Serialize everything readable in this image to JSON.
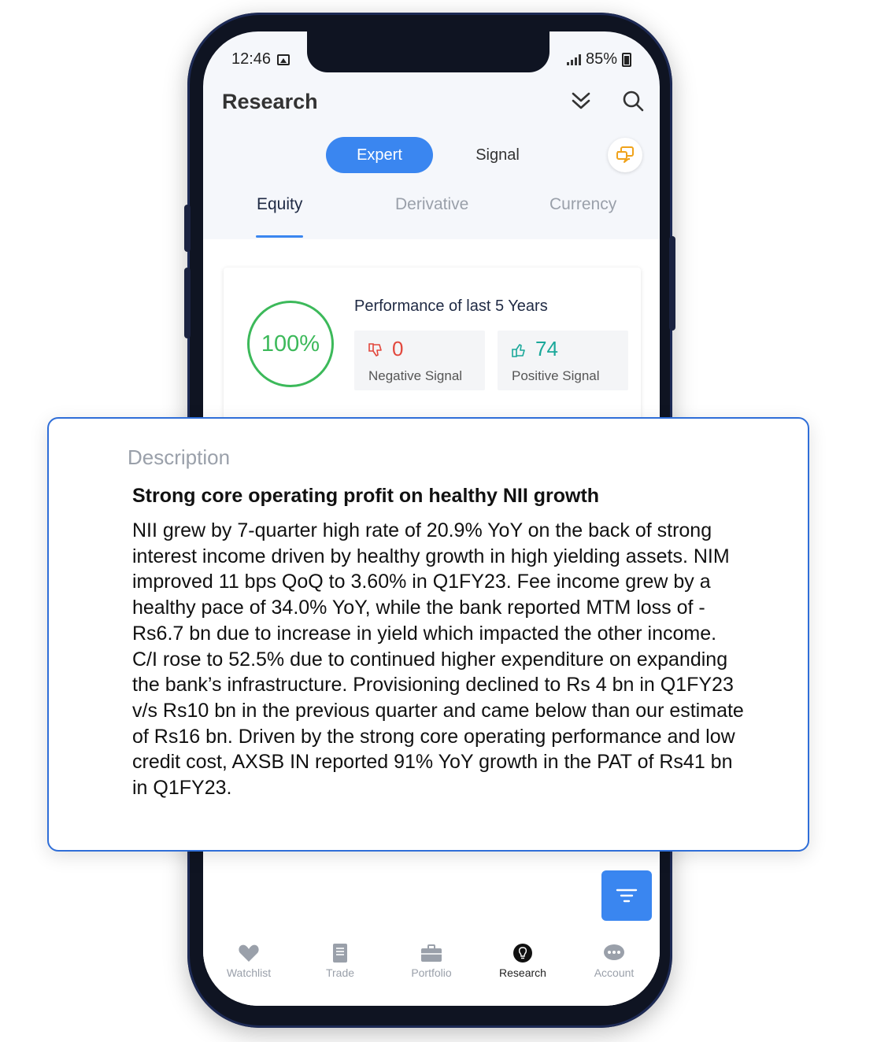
{
  "status_bar": {
    "time": "12:46",
    "battery": "85%"
  },
  "header": {
    "title": "Research",
    "icons": [
      "double-chevron-down-icon",
      "search-icon"
    ]
  },
  "segment": {
    "active": "Expert",
    "inactive": "Signal"
  },
  "tabs": [
    {
      "label": "Equity",
      "active": true
    },
    {
      "label": "Derivative",
      "active": false
    },
    {
      "label": "Currency",
      "active": false
    }
  ],
  "performance": {
    "title": "Performance of last 5 Years",
    "accuracy": "100%",
    "negative": {
      "value": "0",
      "label": "Negative Signal"
    },
    "positive": {
      "value": "74",
      "label": "Positive Signal"
    }
  },
  "description": {
    "label": "Description",
    "heading": "Strong core operating profit on healthy NII growth",
    "body": "NII grew by 7-quarter high rate of 20.9% YoY on the back of strong interest income driven by healthy growth in high yielding assets. NIM improved 11 bps QoQ to 3.60% in Q1FY23. Fee income grew by a healthy pace of 34.0% YoY, while the bank reported MTM loss of -Rs6.7 bn due to increase in yield which impacted the other income. C/I rose to 52.5% due to continued higher expenditure on expanding the bank’s infrastructure. Provisioning declined to Rs 4 bn in Q1FY23 v/s Rs10 bn in the previous quarter and came below than our estimate of Rs16 bn.  Driven by the strong core operating performance and low credit cost, AXSB IN reported 91% YoY growth in the PAT of Rs41 bn in Q1FY23."
  },
  "bottom_nav": [
    {
      "label": "Watchlist",
      "icon": "heart-icon",
      "active": false
    },
    {
      "label": "Trade",
      "icon": "book-icon",
      "active": false
    },
    {
      "label": "Portfolio",
      "icon": "briefcase-icon",
      "active": false
    },
    {
      "label": "Research",
      "icon": "lightbulb-icon",
      "active": true
    },
    {
      "label": "Account",
      "icon": "chat-bubble-icon",
      "active": false
    }
  ],
  "colors": {
    "accent": "#3a86f0",
    "positive": "#1aa89a",
    "negative": "#e2483d",
    "ring": "#3cb95a",
    "chat_icon": "#f0a21a"
  }
}
